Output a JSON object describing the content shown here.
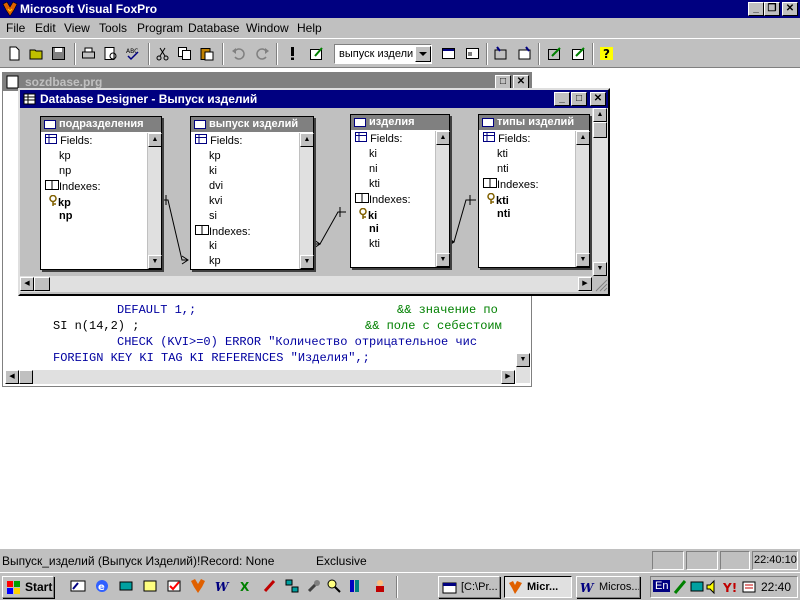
{
  "app": {
    "title": "Microsoft Visual FoxPro",
    "menu": [
      "File",
      "Edit",
      "View",
      "Tools",
      "Program",
      "Database",
      "Window",
      "Help"
    ],
    "toolbar_combo": "выпуск издели"
  },
  "code_window": {
    "title": "sozdbase.prg",
    "lines": [
      {
        "code": "DEFAULT 1,;",
        "comment": "&& значение по"
      },
      {
        "code": "SI n(14,2) ;",
        "comment": "&& поле с себестоим"
      },
      {
        "code": "CHECK (KVI>=0) ERROR \"Количество отрицательное чис"
      },
      {
        "code": "FOREIGN KEY KI TAG KI REFERENCES \"Изделия\",;"
      }
    ]
  },
  "designer": {
    "title": "Database Designer - Выпуск изделий",
    "tables": [
      {
        "name": "подразделения",
        "fields_label": "Fields:",
        "fields": [
          "kp",
          "np"
        ],
        "indexes_label": "Indexes:",
        "indexes": [
          "kp",
          "np"
        ]
      },
      {
        "name": "выпуск изделий",
        "fields_label": "Fields:",
        "fields": [
          "kp",
          "ki",
          "dvi",
          "kvi",
          "si"
        ],
        "indexes_label": "Indexes:",
        "indexes": [
          "ki",
          "kp"
        ]
      },
      {
        "name": "изделия",
        "fields_label": "Fields:",
        "fields": [
          "ki",
          "ni",
          "kti"
        ],
        "indexes_label": "Indexes:",
        "indexes": [
          "ki",
          "ni",
          "kti"
        ]
      },
      {
        "name": "типы изделий",
        "fields_label": "Fields:",
        "fields": [
          "kti",
          "nti"
        ],
        "indexes_label": "Indexes:",
        "indexes": [
          "kti",
          "nti"
        ]
      }
    ]
  },
  "status": {
    "left": "Выпуск_изделий (Выпуск Изделий)!Record: None",
    "mode": "Exclusive",
    "time": "22:40:10"
  },
  "taskbar": {
    "start": "Start",
    "tasks": [
      "[C:\\Pr...",
      "Micr...",
      "Micros..."
    ],
    "lang": "En",
    "clock": "22:40"
  },
  "icons": {
    "app": "foxpro-icon",
    "start": "windows-logo-icon"
  }
}
